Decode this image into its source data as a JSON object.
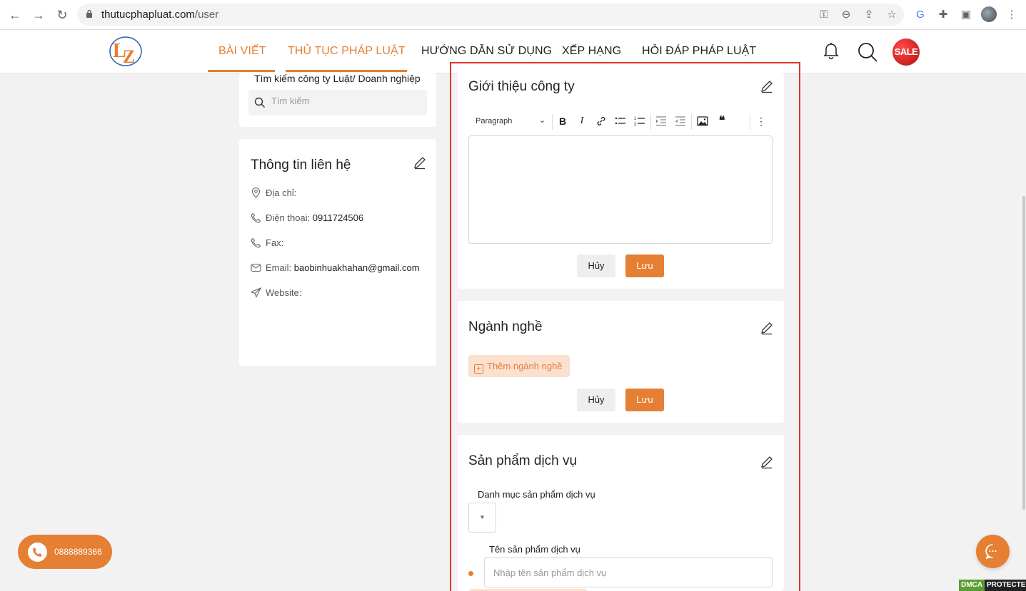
{
  "browser": {
    "url_domain": "thutucphapluat.com",
    "url_path": "/user"
  },
  "header": {
    "nav": [
      {
        "label": "BÀI VIẾT",
        "active": true
      },
      {
        "label": "THỦ TỤC PHÁP LUẬT",
        "active": true
      },
      {
        "label": "HƯỚNG DẪN SỬ DỤNG",
        "active": false
      },
      {
        "label": "XẾP HẠNG",
        "active": false
      },
      {
        "label": "HỎI ĐÁP PHÁP LUẬT",
        "active": false
      }
    ],
    "sale_badge": "SALE",
    "accent_color": "#e57f33"
  },
  "search_panel": {
    "title": "Tìm kiếm công ty Luật/ Doanh nghiệp",
    "placeholder": "Tìm kiếm"
  },
  "contact": {
    "title": "Thông tin liên hệ",
    "address_label": "Địa chỉ:",
    "phone_label": "Điện thoại:",
    "phone_value": "0911724506",
    "fax_label": "Fax:",
    "email_label": "Email:",
    "email_value": "baobinhuakhahan@gmail.com",
    "website_label": "Website:"
  },
  "intro": {
    "title": "Giới thiệu công ty",
    "format_select": "Paragraph",
    "cancel_label": "Hủy",
    "save_label": "Lưu"
  },
  "industry": {
    "title": "Ngành nghề",
    "add_label": "Thêm ngành nghề",
    "cancel_label": "Hủy",
    "save_label": "Lưu"
  },
  "products": {
    "title": "Sản phẩm dịch vụ",
    "category_label": "Danh mục sản phẩm dịch vụ",
    "name_label": "Tên sản phẩm dịch vụ",
    "name_placeholder": "Nhập tên sản phẩm dịch vụ"
  },
  "floating": {
    "hotline": "0888889366",
    "dmca_left": "DMCA",
    "dmca_right": "PROTECTED"
  }
}
